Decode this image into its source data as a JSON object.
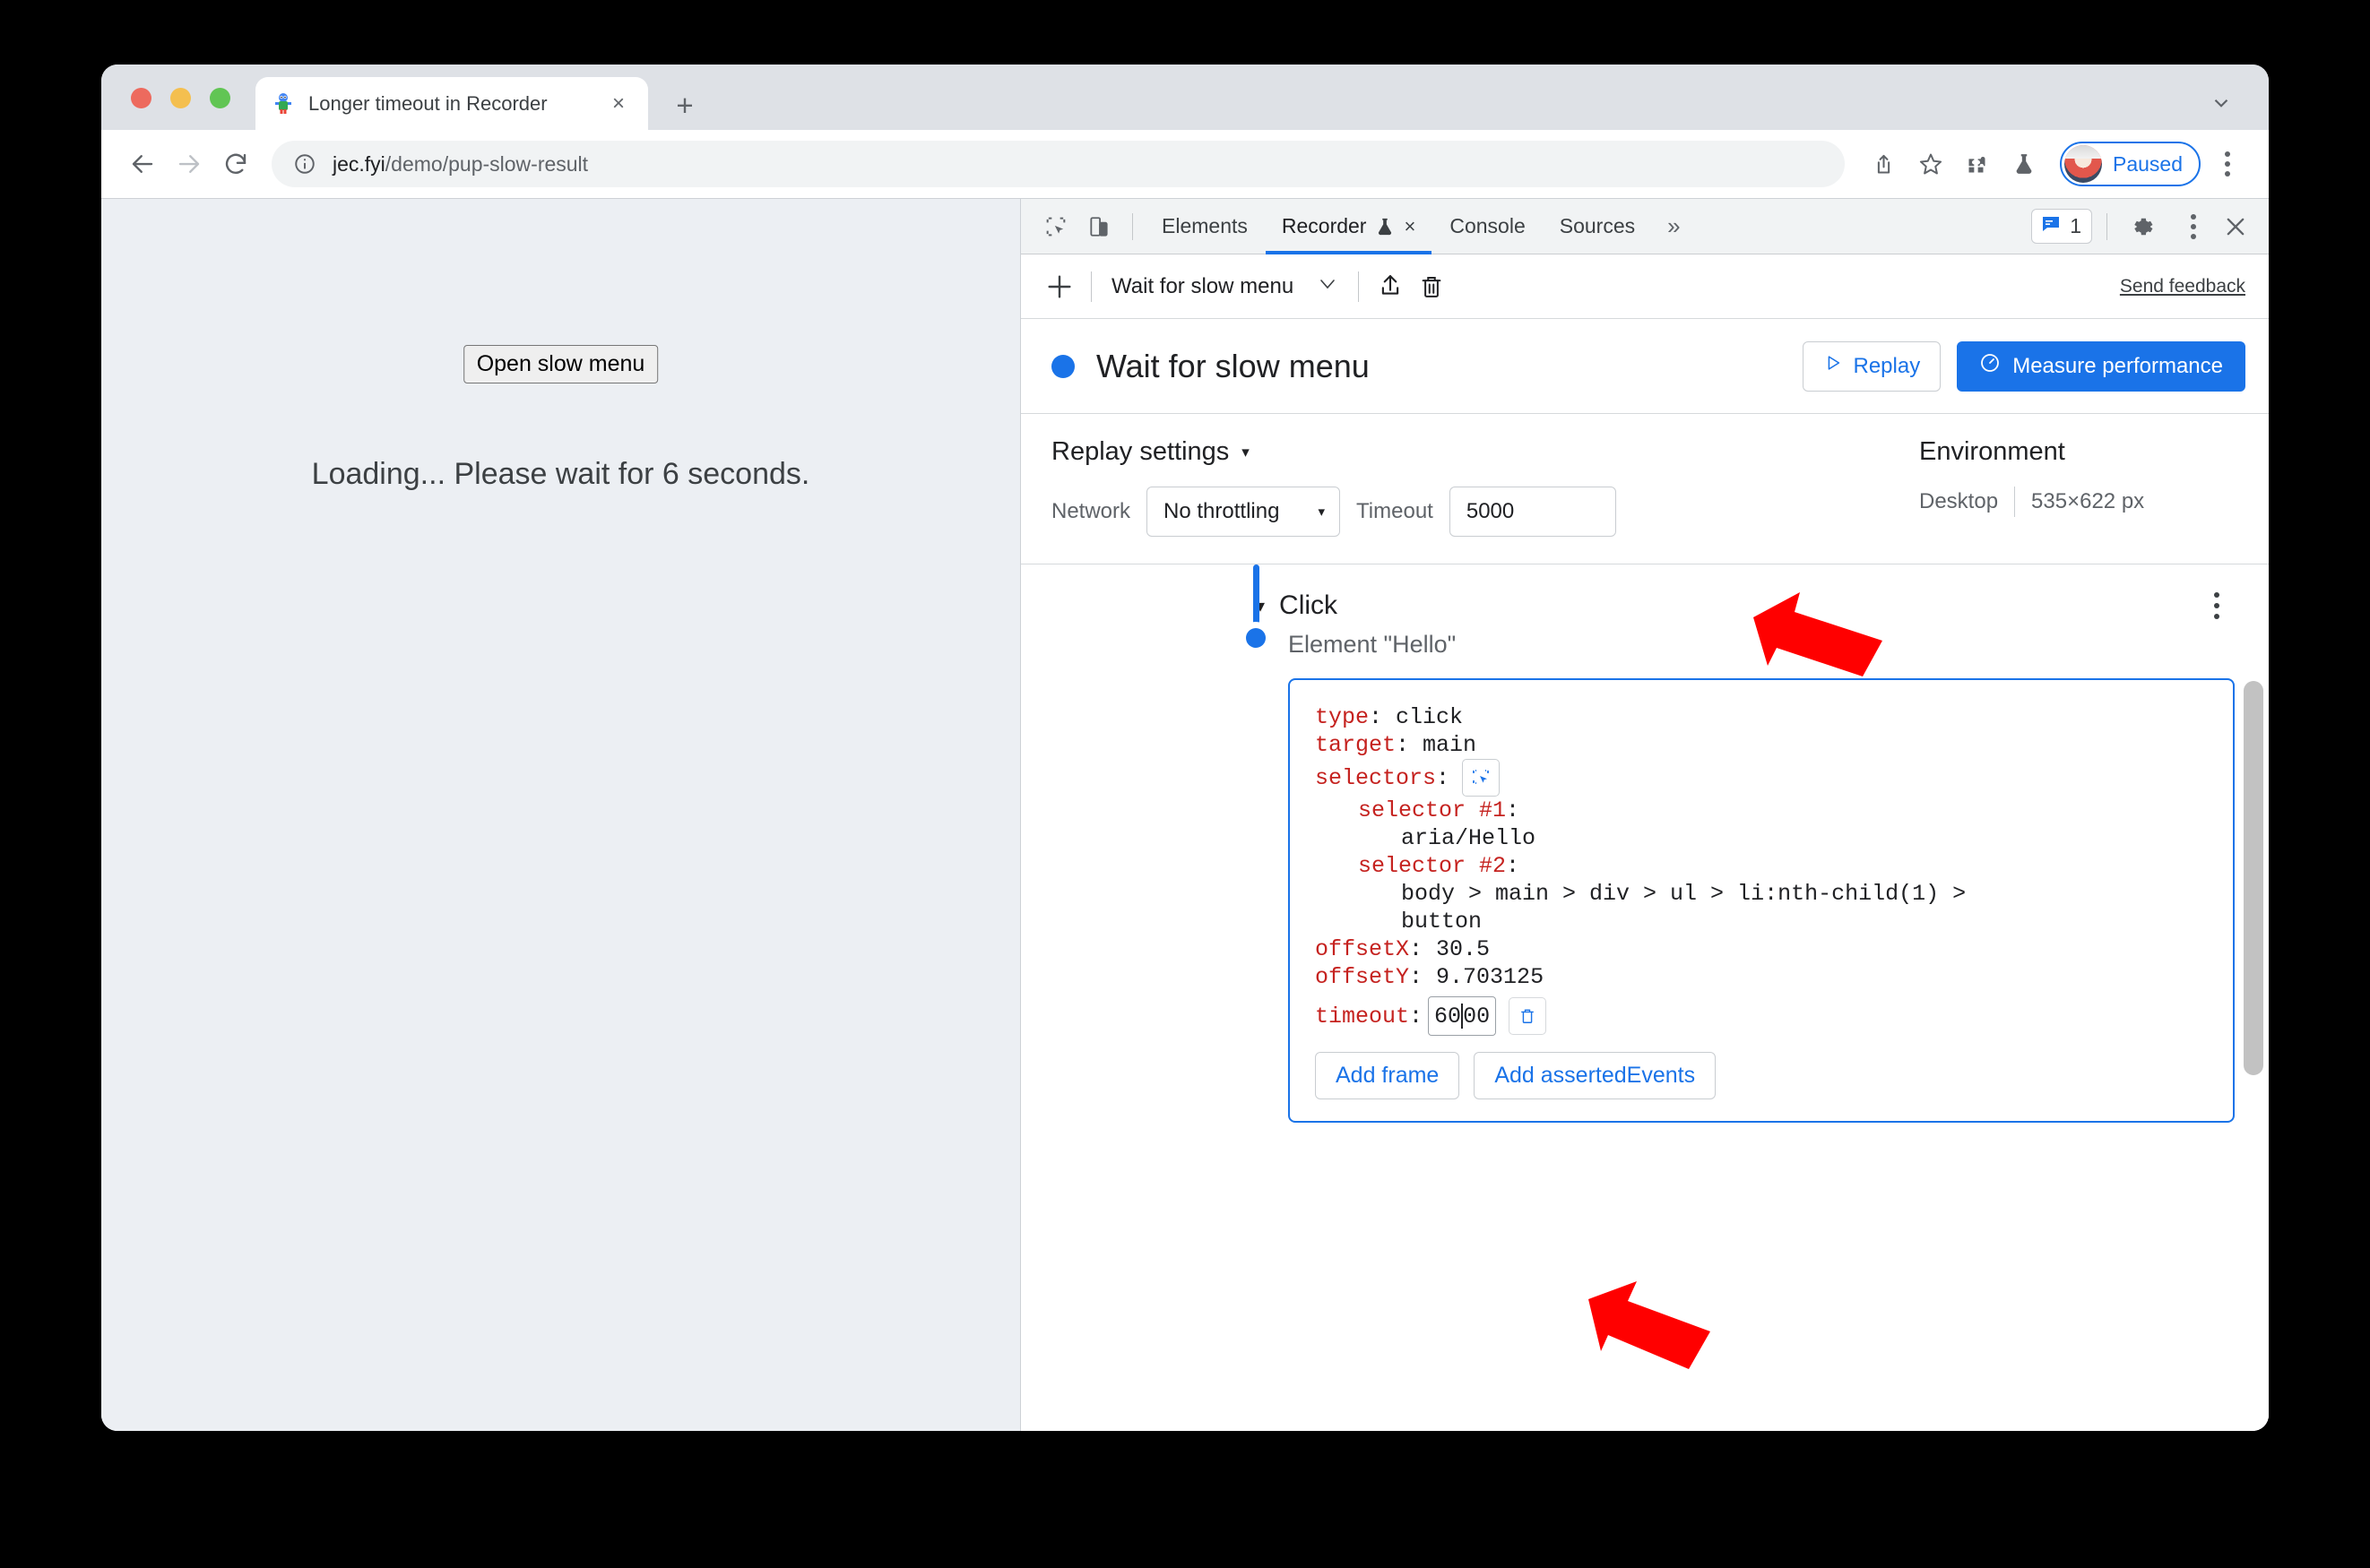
{
  "browser": {
    "tab": {
      "title": "Longer timeout in Recorder",
      "favicon": "puppeteer-icon",
      "close_label": "×"
    },
    "new_tab_label": "+",
    "tabstrip_chevron": "chevron-down-icon",
    "nav": {
      "back": "back-arrow-icon",
      "forward": "forward-arrow-icon",
      "reload": "reload-icon"
    },
    "omnibox": {
      "info_icon": "info-circle-icon",
      "url_host": "jec.fyi",
      "url_path": "/demo/pup-slow-result"
    },
    "toolbar_icons": [
      "share-icon",
      "star-icon",
      "extensions-puzzle-icon",
      "flask-icon"
    ],
    "profile": {
      "label": "Paused",
      "avatar": "user-avatar"
    },
    "menu": "kebab-menu-icon"
  },
  "page": {
    "open_menu_button": "Open slow menu",
    "loading_text": "Loading... Please wait for 6 seconds."
  },
  "devtools": {
    "left_icons": [
      "inspect-element-icon",
      "device-toolbar-icon"
    ],
    "tabs": [
      {
        "label": "Elements",
        "active": false
      },
      {
        "label": "Recorder",
        "active": true,
        "experiment_icon": "flask-icon",
        "close": "×"
      },
      {
        "label": "Console",
        "active": false
      },
      {
        "label": "Sources",
        "active": false
      }
    ],
    "more_tabs": "»",
    "messages": {
      "icon": "console-message-icon",
      "count": "1"
    },
    "settings_icon": "gear-icon",
    "kebab_icon": "kebab-menu-icon",
    "close_icon": "close-icon"
  },
  "recorder": {
    "toolbar": {
      "add_icon": "plus-icon",
      "selected_recording": "Wait for slow menu",
      "dropdown_caret": "⌄",
      "export_icon": "export-upload-icon",
      "delete_icon": "trash-icon",
      "send_feedback": "Send feedback"
    },
    "header": {
      "status_dot": "blue-dot",
      "title": "Wait for slow menu",
      "replay_button": "Replay",
      "replay_icon": "play-triangle-icon",
      "measure_button": "Measure performance",
      "measure_icon": "performance-gauge-icon"
    },
    "settings": {
      "title": "Replay settings",
      "caret": "▾",
      "network_label": "Network",
      "network_value": "No throttling",
      "network_caret": "▾",
      "timeout_label": "Timeout",
      "timeout_value": "5000"
    },
    "environment": {
      "title": "Environment",
      "device": "Desktop",
      "viewport": "535×622 px"
    },
    "step": {
      "caret": "▾",
      "name": "Click",
      "subtitle": "Element \"Hello\"",
      "kebab": "kebab-menu-icon",
      "code": {
        "type_key": "type",
        "type_value": "click",
        "target_key": "target",
        "target_value": "main",
        "selectors_key": "selectors",
        "selectors_picker_icon": "selector-picker-icon",
        "selector1_key": "selector #1",
        "selector1_value": "aria/Hello",
        "selector2_key": "selector #2",
        "selector2_value_line1": "body > main > div > ul > li:nth-child(1) >",
        "selector2_value_line2": "button",
        "offsetx_key": "offsetX",
        "offsetx_value": "30.5",
        "offsety_key": "offsetY",
        "offsety_value": "9.703125",
        "timeout_key": "timeout",
        "timeout_value_before": "60",
        "timeout_value_after": "00",
        "timeout_delete_icon": "trash-icon",
        "add_frame_button": "Add frame",
        "add_asserted_events_button": "Add assertedEvents"
      }
    }
  },
  "annotations": {
    "arrow_color": "#ff0000",
    "arrow_targets": [
      "replay-settings-timeout-field",
      "step-timeout-field"
    ]
  }
}
